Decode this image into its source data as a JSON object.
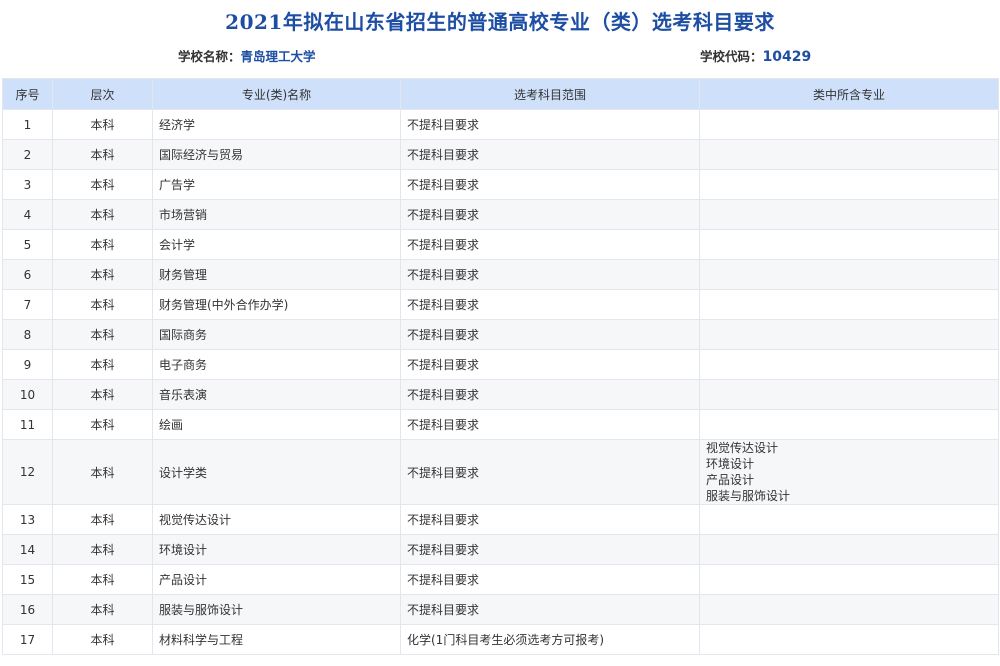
{
  "header": {
    "title": "2021年拟在山东省招生的普通高校专业（类）选考科目要求",
    "school_label": "学校名称：",
    "school_name": "青岛理工大学",
    "code_label": "学校代码：",
    "code_value": "10429"
  },
  "table": {
    "columns": [
      "序号",
      "层次",
      "专业(类)名称",
      "选考科目范围",
      "类中所含专业"
    ],
    "rows": [
      {
        "no": "1",
        "level": "本科",
        "major": "经济学",
        "requirement": "不提科目要求",
        "included": []
      },
      {
        "no": "2",
        "level": "本科",
        "major": "国际经济与贸易",
        "requirement": "不提科目要求",
        "included": []
      },
      {
        "no": "3",
        "level": "本科",
        "major": "广告学",
        "requirement": "不提科目要求",
        "included": []
      },
      {
        "no": "4",
        "level": "本科",
        "major": "市场营销",
        "requirement": "不提科目要求",
        "included": []
      },
      {
        "no": "5",
        "level": "本科",
        "major": "会计学",
        "requirement": "不提科目要求",
        "included": []
      },
      {
        "no": "6",
        "level": "本科",
        "major": "财务管理",
        "requirement": "不提科目要求",
        "included": []
      },
      {
        "no": "7",
        "level": "本科",
        "major": "财务管理(中外合作办学)",
        "requirement": "不提科目要求",
        "included": []
      },
      {
        "no": "8",
        "level": "本科",
        "major": "国际商务",
        "requirement": "不提科目要求",
        "included": []
      },
      {
        "no": "9",
        "level": "本科",
        "major": "电子商务",
        "requirement": "不提科目要求",
        "included": []
      },
      {
        "no": "10",
        "level": "本科",
        "major": "音乐表演",
        "requirement": "不提科目要求",
        "included": []
      },
      {
        "no": "11",
        "level": "本科",
        "major": "绘画",
        "requirement": "不提科目要求",
        "included": []
      },
      {
        "no": "12",
        "level": "本科",
        "major": "设计学类",
        "requirement": "不提科目要求",
        "included": [
          "视觉传达设计",
          "环境设计",
          "产品设计",
          "服装与服饰设计"
        ]
      },
      {
        "no": "13",
        "level": "本科",
        "major": "视觉传达设计",
        "requirement": "不提科目要求",
        "included": []
      },
      {
        "no": "14",
        "level": "本科",
        "major": "环境设计",
        "requirement": "不提科目要求",
        "included": []
      },
      {
        "no": "15",
        "level": "本科",
        "major": "产品设计",
        "requirement": "不提科目要求",
        "included": []
      },
      {
        "no": "16",
        "level": "本科",
        "major": "服装与服饰设计",
        "requirement": "不提科目要求",
        "included": []
      },
      {
        "no": "17",
        "level": "本科",
        "major": "材料科学与工程",
        "requirement": "化学(1门科目考生必须选考方可报考)",
        "included": []
      }
    ]
  }
}
